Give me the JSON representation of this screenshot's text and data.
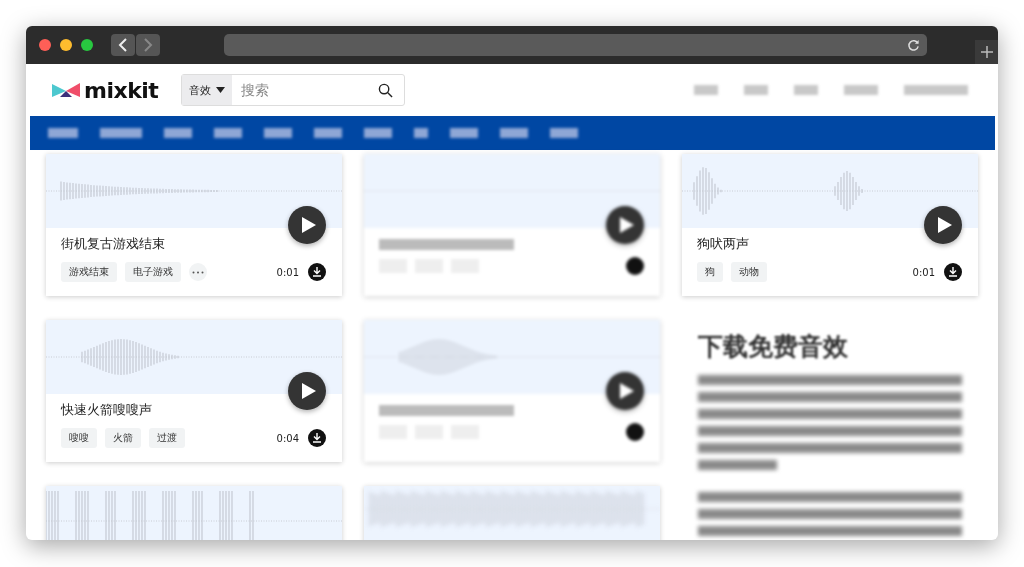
{
  "header": {
    "logo": "mixkit",
    "search": {
      "category": "音效",
      "placeholder": "搜索"
    }
  },
  "cards": [
    {
      "kind": "sound",
      "title": "街机复古游戏结束",
      "tags": [
        "游戏结束",
        "电子游戏"
      ],
      "more": true,
      "duration": "0:01"
    },
    {
      "kind": "blurred"
    },
    {
      "kind": "sound",
      "title": "狗吠两声",
      "tags": [
        "狗",
        "动物"
      ],
      "more": false,
      "duration": "0:01"
    },
    {
      "kind": "sound",
      "title": "快速火箭嗖嗖声",
      "tags": [
        "嗖嗖",
        "火箭",
        "过渡"
      ],
      "more": false,
      "duration": "0:04"
    },
    {
      "kind": "blurred"
    },
    {
      "kind": "partial"
    },
    {
      "kind": "partial"
    }
  ],
  "sidebar": {
    "heading": "下载免费音效"
  }
}
